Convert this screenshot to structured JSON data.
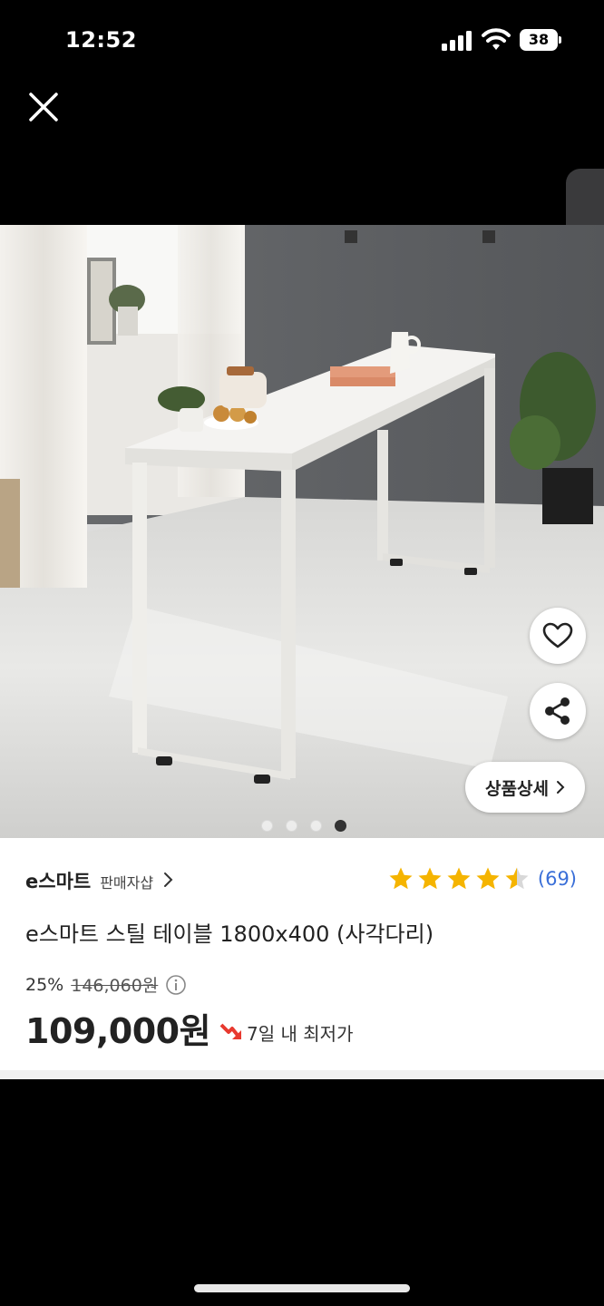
{
  "status_bar": {
    "time": "12:52",
    "battery": "38"
  },
  "product": {
    "image_dots": {
      "count": 4,
      "active_index": 3
    },
    "detail_button": "상품상세",
    "seller_name": "e스마트",
    "seller_link": "판매자샵",
    "rating": {
      "stars": 4.5,
      "count": "(69)"
    },
    "title": "e스마트 스틸 테이블 1800x400 (사각다리)",
    "discount": "25%",
    "original_price": "146,060원",
    "price": "109,000원",
    "low_price_badge": "7일 내 최저가"
  },
  "colors": {
    "star": "#f5b400",
    "rating_count": "#3a6fd8",
    "badge_icon": "#e8392f"
  },
  "icons": [
    "close-icon",
    "chevron-left-icon",
    "heart-icon",
    "share-icon",
    "chevron-right-icon",
    "star-icon",
    "info-icon",
    "trend-down-icon"
  ]
}
